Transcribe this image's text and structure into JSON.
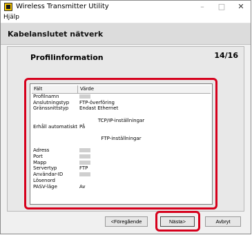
{
  "window": {
    "title": "Wireless Transmitter Utility",
    "minimize_glyph": "–",
    "maximize_glyph": "□",
    "close_glyph": "✕"
  },
  "menubar": {
    "help": "Hjälp"
  },
  "header": {
    "title": "Kabelanslutet nätverk"
  },
  "panel": {
    "title": "Profilinformation",
    "step": "14/16"
  },
  "table": {
    "headers": [
      "Fält",
      "Värde"
    ],
    "rows": [
      {
        "field": "Profilnamn",
        "value": "",
        "redacted": true
      },
      {
        "field": "Anslutningstyp",
        "value": "FTP-överföring"
      },
      {
        "field": "Gränssnittstyp",
        "value": "Endast Ethernet"
      },
      {
        "field": "",
        "value": ""
      },
      {
        "section": "TCP/IP-inställningar"
      },
      {
        "field": "Erhåll automatiskt",
        "value": "På"
      },
      {
        "field": "",
        "value": ""
      },
      {
        "section": "FTP-inställningar"
      },
      {
        "field": "",
        "value": ""
      },
      {
        "field": "Adress",
        "value": "",
        "redacted": true
      },
      {
        "field": "Port",
        "value": "",
        "redacted": true
      },
      {
        "field": "Mapp",
        "value": "",
        "redacted": true
      },
      {
        "field": "Servertyp",
        "value": "FTP"
      },
      {
        "field": "Användar-ID",
        "value": "",
        "redacted": true
      },
      {
        "field": "Lösenord",
        "value": ""
      },
      {
        "field": "PASV-läge",
        "value": "Av"
      }
    ]
  },
  "buttons": {
    "back": "<Föregående",
    "next": "Nästa>",
    "cancel": "Avbryt"
  },
  "colors": {
    "highlight": "#d6001c",
    "header_bg": "#dcdcdc",
    "panel_bg": "#e8e8e8",
    "app_icon": "#f2c200"
  },
  "icons": {
    "app": "wireless-transmitter-app-icon"
  }
}
